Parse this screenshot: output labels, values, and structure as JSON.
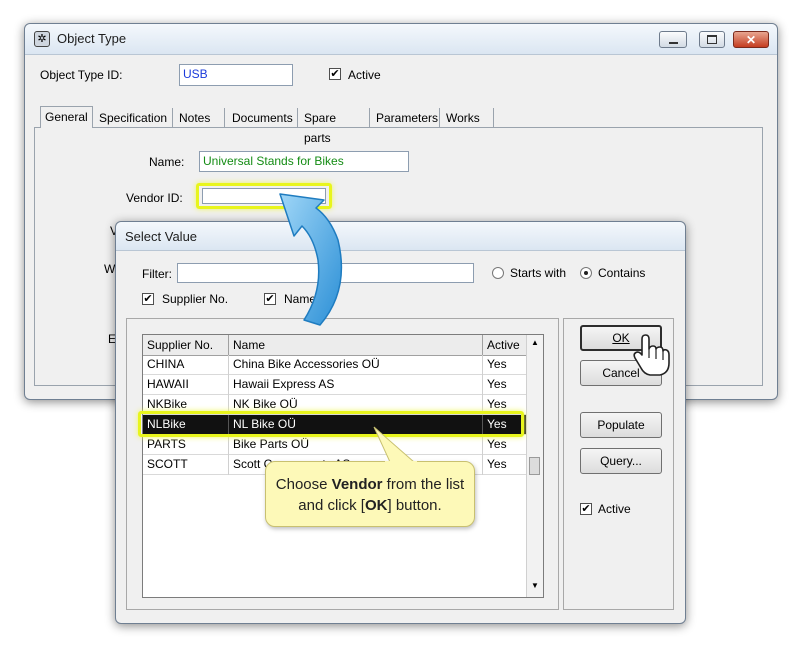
{
  "main_window": {
    "title": "Object Type",
    "object_type_id_label": "Object Type ID:",
    "object_type_id_value": "USB",
    "active_label": "Active",
    "active_checked": "✔",
    "tabs": [
      {
        "label": "General"
      },
      {
        "label": "Specification"
      },
      {
        "label": "Notes"
      },
      {
        "label": "Documents"
      },
      {
        "label": "Spare parts"
      },
      {
        "label": "Parameters"
      },
      {
        "label": "Works"
      }
    ],
    "name_label": "Name:",
    "name_value": "Universal Stands for Bikes",
    "vendor_id_label": "Vendor ID:",
    "vendor_id_value": "",
    "hidden_label_v": "V",
    "hidden_label_w": "W",
    "hidden_label_e": "E"
  },
  "dialog": {
    "title": "Select Value",
    "filter_label": "Filter:",
    "filter_value": "",
    "starts_with_label": "Starts with",
    "contains_label": "Contains",
    "supplier_no_label": "Supplier No.",
    "name_label": "Name",
    "check_mark": "✔",
    "columns": [
      "Supplier No.",
      "Name",
      "Active"
    ],
    "rows": [
      {
        "supplier": "CHINA",
        "name": "China Bike Accessories OÜ",
        "active": "Yes"
      },
      {
        "supplier": "HAWAII",
        "name": "Hawaii Express AS",
        "active": "Yes"
      },
      {
        "supplier": "NKBike",
        "name": "NK Bike OÜ",
        "active": "Yes"
      },
      {
        "supplier": "NLBike",
        "name": "NL Bike OÜ",
        "active": "Yes"
      },
      {
        "supplier": "PARTS",
        "name": "Bike Parts OÜ",
        "active": "Yes"
      },
      {
        "supplier": "SCOTT",
        "name": "Scott Components AS",
        "active": "Yes"
      }
    ],
    "ok_label": "OK",
    "cancel_label": "Cancel",
    "populate_label": "Populate",
    "query_label": "Query...",
    "active_label": "Active"
  },
  "callout": {
    "text_1": "Choose ",
    "text_bold_1": "Vendor",
    "text_2": " from the list and click [",
    "text_bold_2": "OK",
    "text_3": "] button."
  },
  "colors": {
    "highlight": "#e8f51c",
    "arrow": "#3a9fe0",
    "id_text": "#1a3adb",
    "name_text": "#148c14"
  }
}
